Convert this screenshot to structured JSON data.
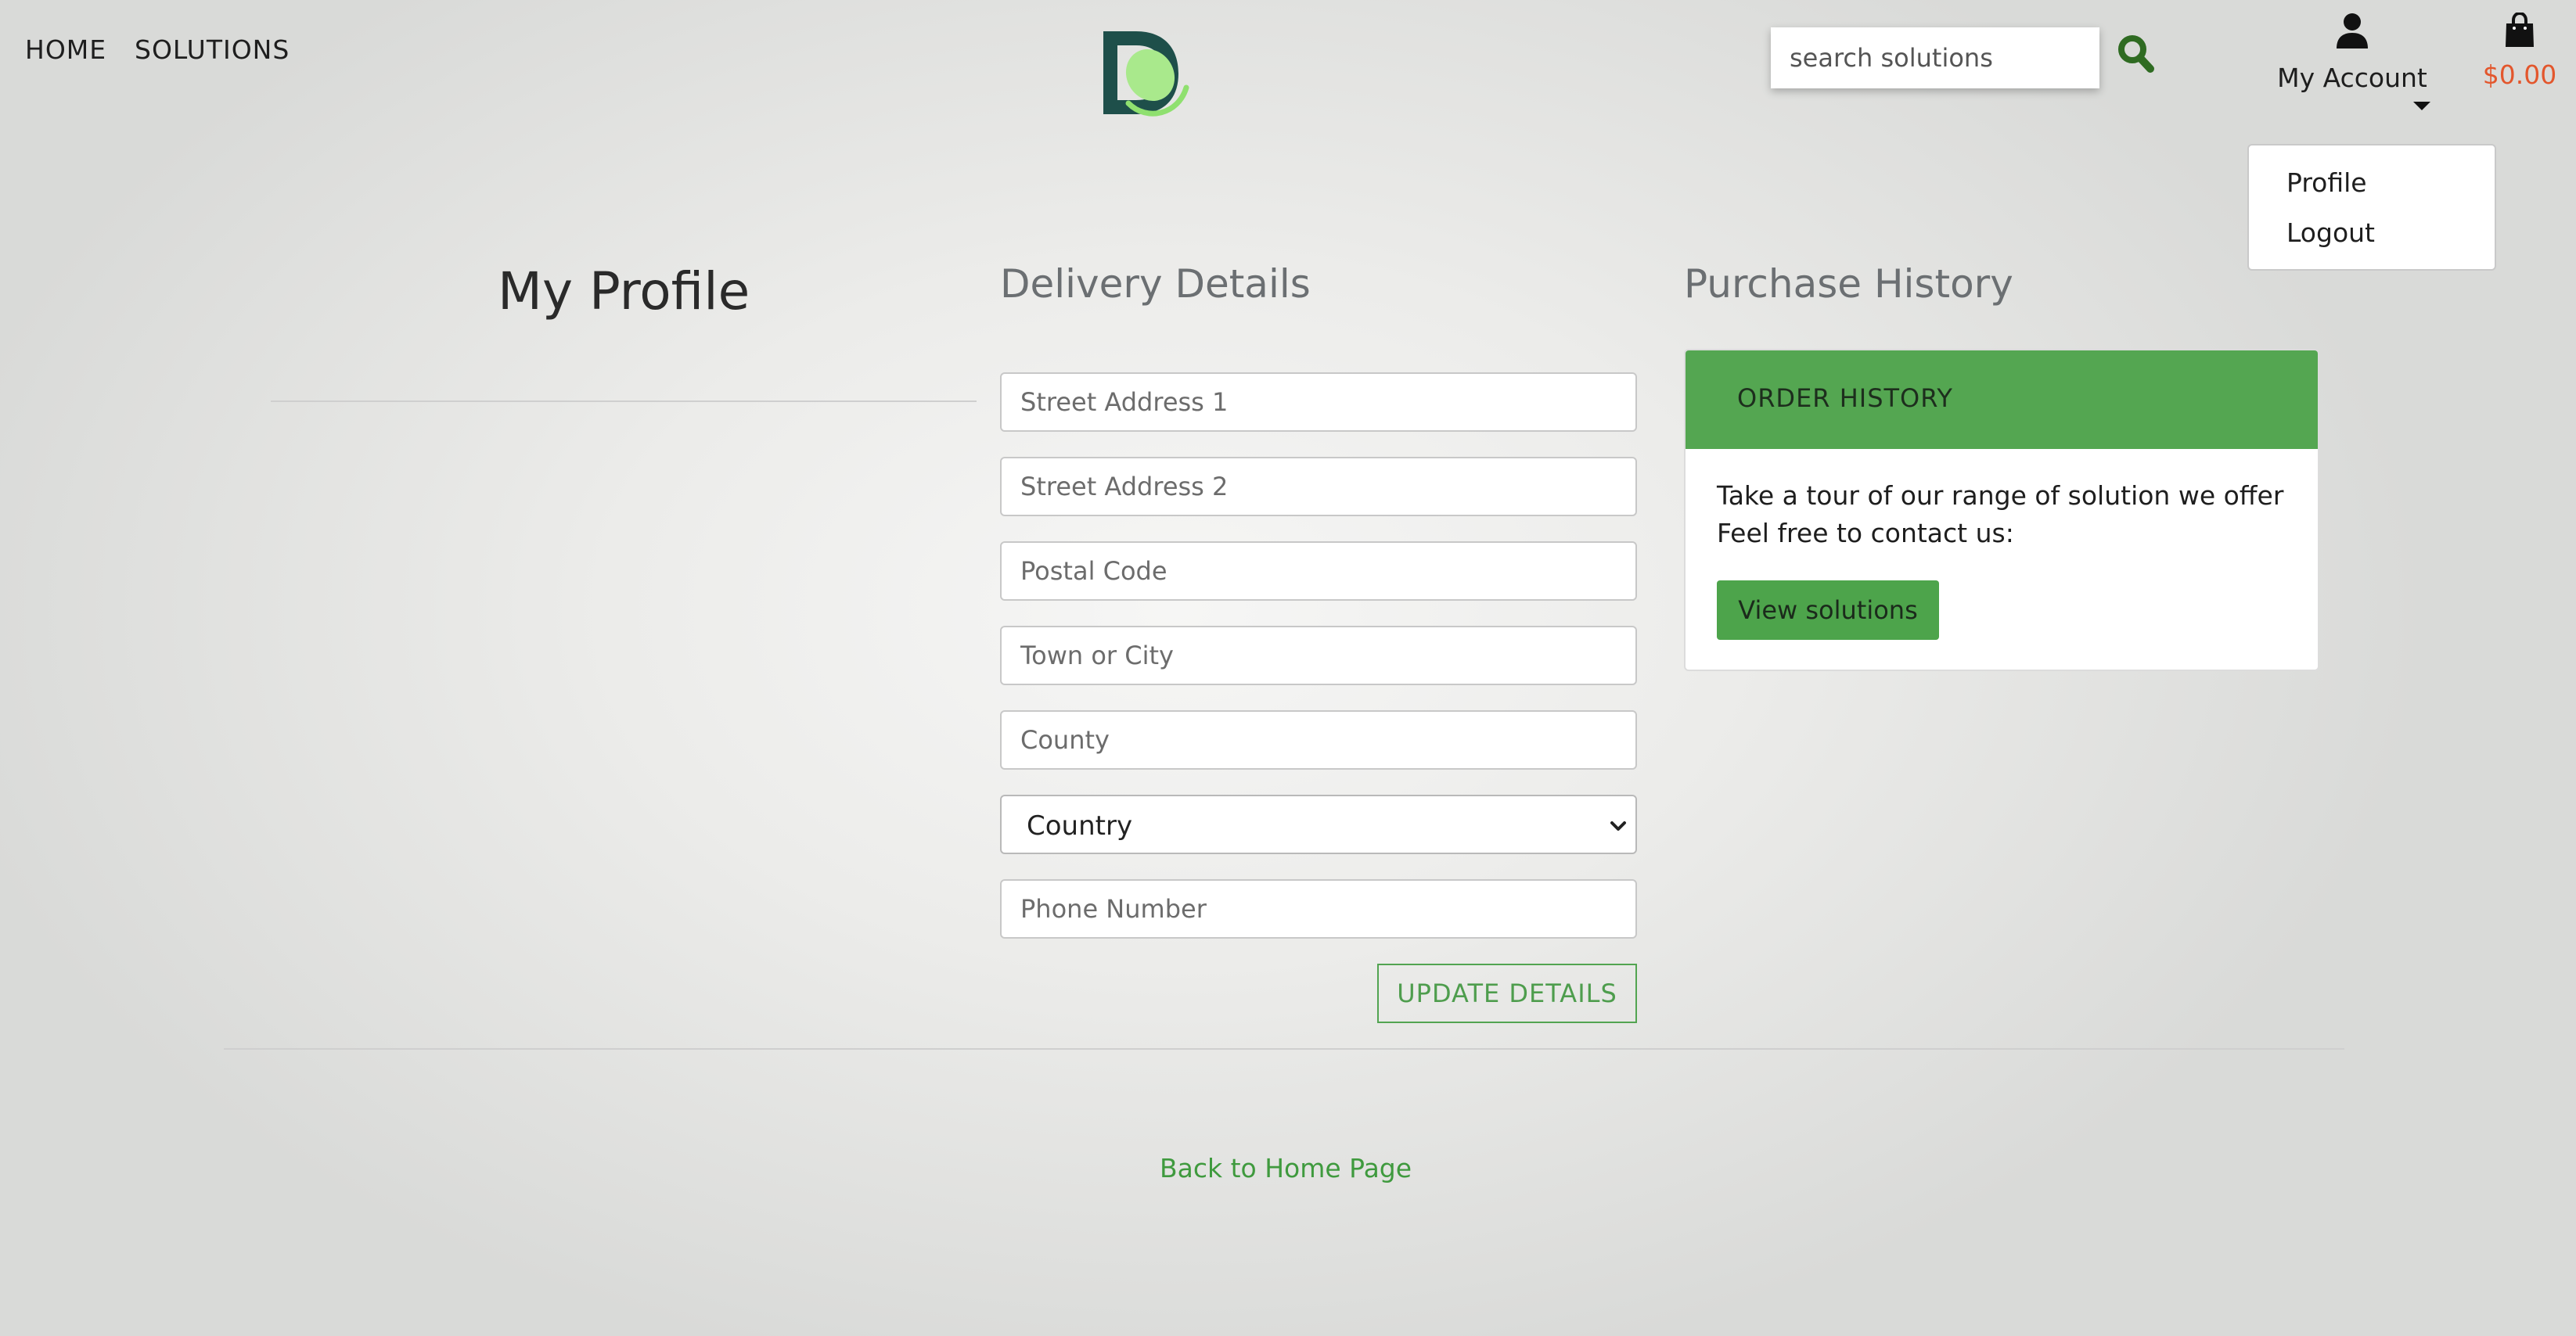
{
  "nav": {
    "home_label": "HOME",
    "solutions_label": "SOLUTIONS"
  },
  "search": {
    "placeholder": "search solutions"
  },
  "account": {
    "label": "My Account",
    "dropdown": [
      "Profile",
      "Logout"
    ]
  },
  "cart": {
    "total": "$0.00"
  },
  "profile": {
    "title": "My Profile"
  },
  "delivery": {
    "heading": "Delivery Details",
    "fields": {
      "street1": "Street Address 1",
      "street2": "Street Address 2",
      "postcode": "Postal Code",
      "town": "Town or City",
      "county": "County",
      "country": "Country",
      "phone": "Phone Number"
    },
    "update_label": "UPDATE DETAILS"
  },
  "purchase": {
    "heading": "Purchase History",
    "card_header": "ORDER HISTORY",
    "line1": "Take a tour of our range of solution we offer",
    "line2": "Feel free to contact us:",
    "button_label": "View solutions"
  },
  "footer": {
    "back_label": "Back to Home Page"
  },
  "colors": {
    "accent_green": "#54a651",
    "cart_total": "#e3562c",
    "search_icon": "#2f6b22"
  },
  "icons": {
    "search": "search-icon",
    "account": "user-icon",
    "cart": "shopping-bag-icon",
    "select": "chevron-down-icon"
  }
}
